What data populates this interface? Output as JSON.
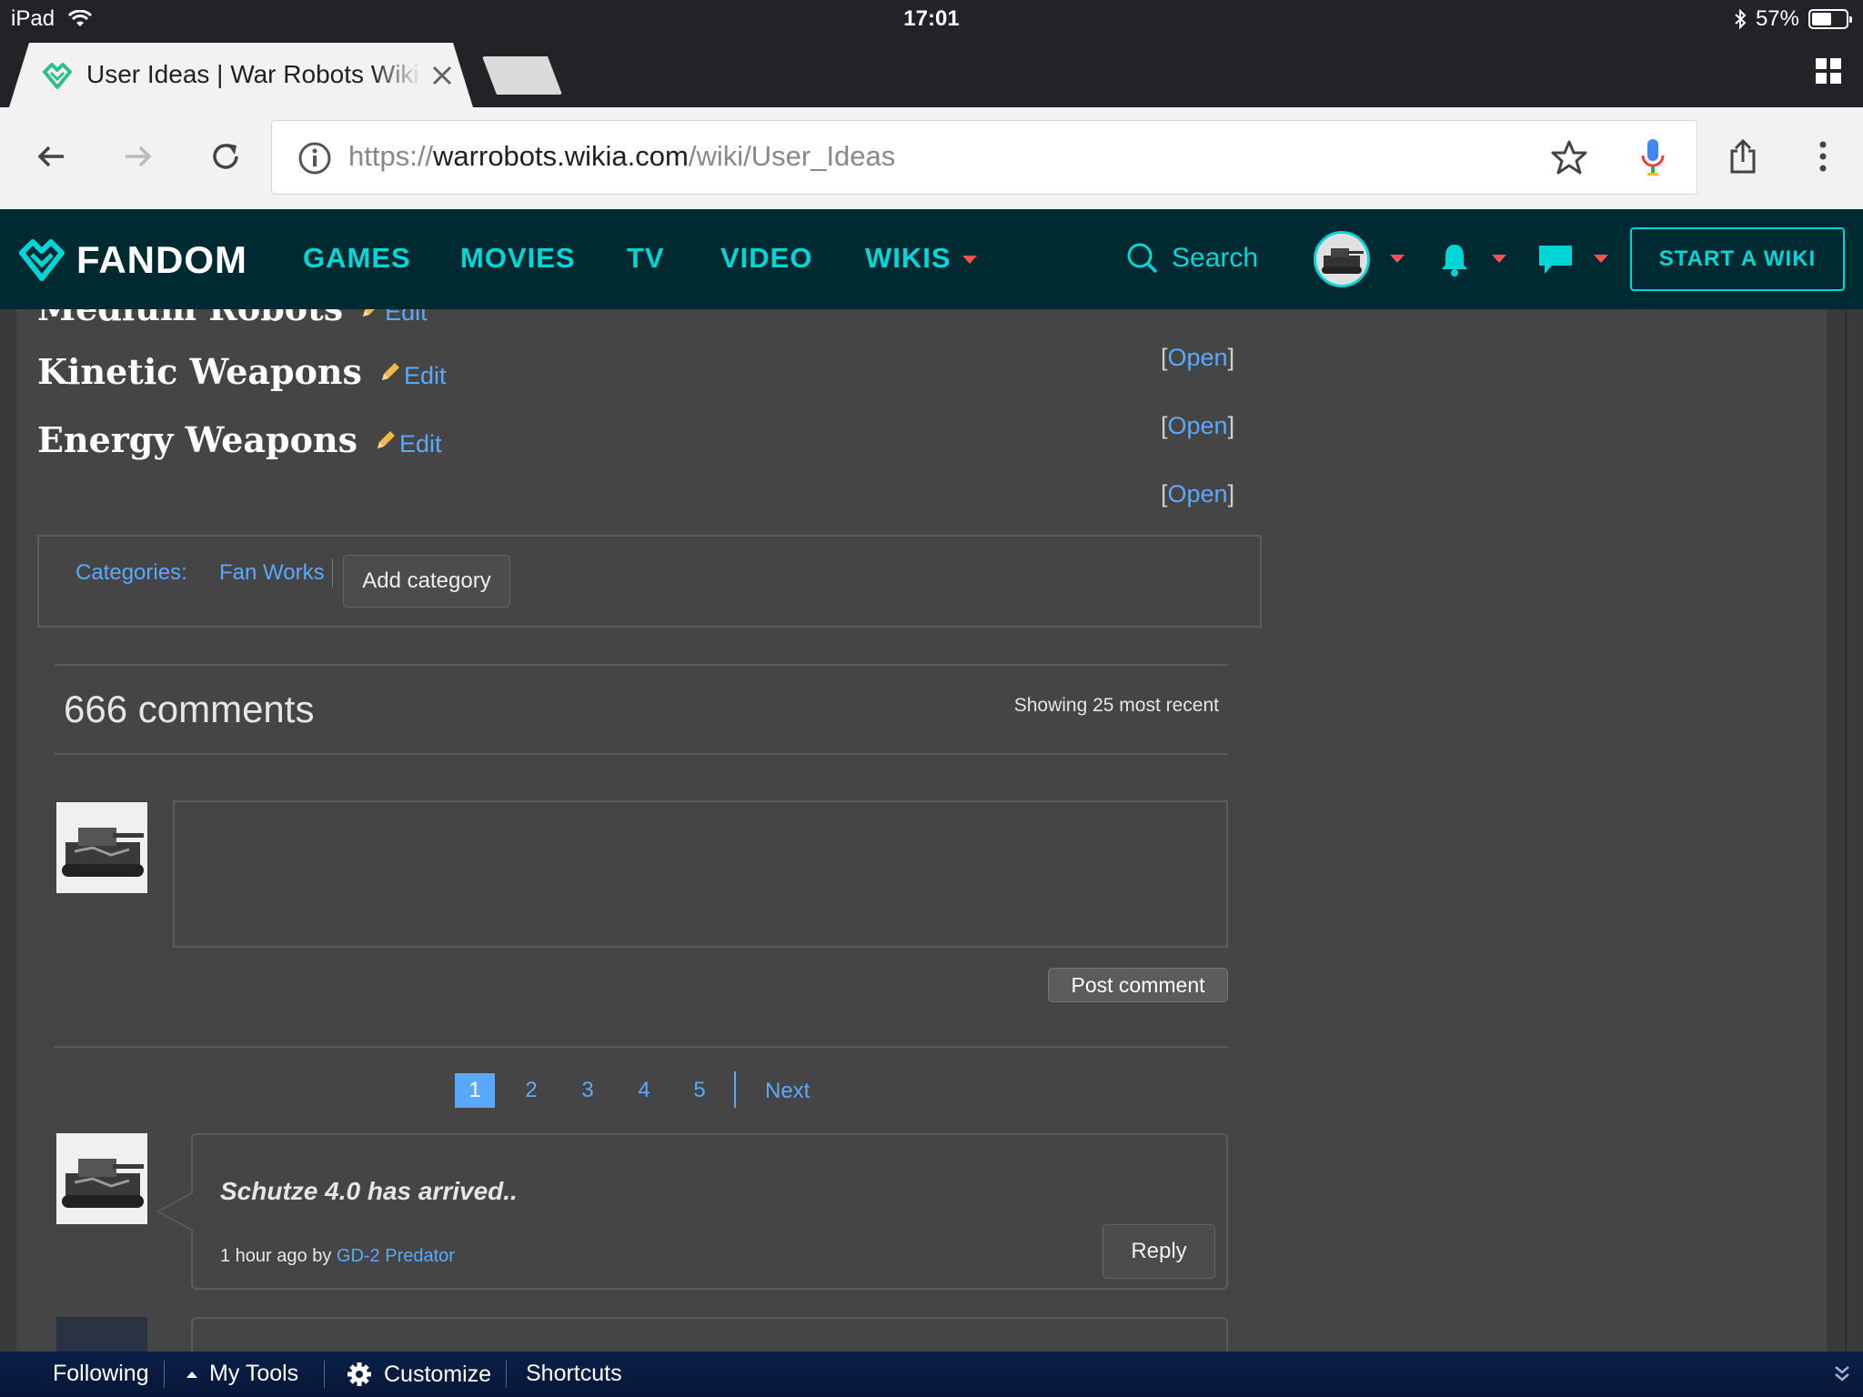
{
  "status_bar": {
    "device": "iPad",
    "time": "17:01",
    "battery": "57%",
    "battery_level": 0.57
  },
  "browser": {
    "tab_title": "User Ideas | War Robots Wiki",
    "url_scheme": "https://",
    "url_host": "warrobots.wikia.com",
    "url_path": "/wiki/User_Ideas"
  },
  "fandom_nav": {
    "logo": "FANDOM",
    "links": [
      "GAMES",
      "MOVIES",
      "TV",
      "VIDEO",
      "WIKIS"
    ],
    "search_label": "Search",
    "start_wiki": "START A WIKI",
    "accent": "#00d6d6"
  },
  "sections": [
    {
      "title": "Medium Robots",
      "edit": "Edit"
    },
    {
      "title": "Kinetic Weapons",
      "edit": "Edit"
    },
    {
      "title": "Energy Weapons",
      "edit": "Edit"
    }
  ],
  "open_link": "Open",
  "categories": {
    "label": "Categories",
    "items": [
      "Fan Works"
    ],
    "add_button": "Add category"
  },
  "comments": {
    "count": "666 comments",
    "showing": "Showing 25 most recent",
    "post_button": "Post comment",
    "pagination": {
      "pages": [
        "1",
        "2",
        "3",
        "4",
        "5"
      ],
      "current": "1",
      "next": "Next"
    },
    "items": [
      {
        "text": "Schutze 4.0 has arrived..",
        "time": "1 hour ago by",
        "user": "GD-2 Predator",
        "reply": "Reply"
      }
    ]
  },
  "bottom_toolbar": {
    "following": "Following",
    "my_tools": "My Tools",
    "customize": "Customize",
    "shortcuts": "Shortcuts"
  },
  "colors": {
    "link": "#5aa9ff",
    "nav_bg": "#002a32",
    "page_bg": "#454545",
    "toolbar_bg": "#0b2048"
  }
}
